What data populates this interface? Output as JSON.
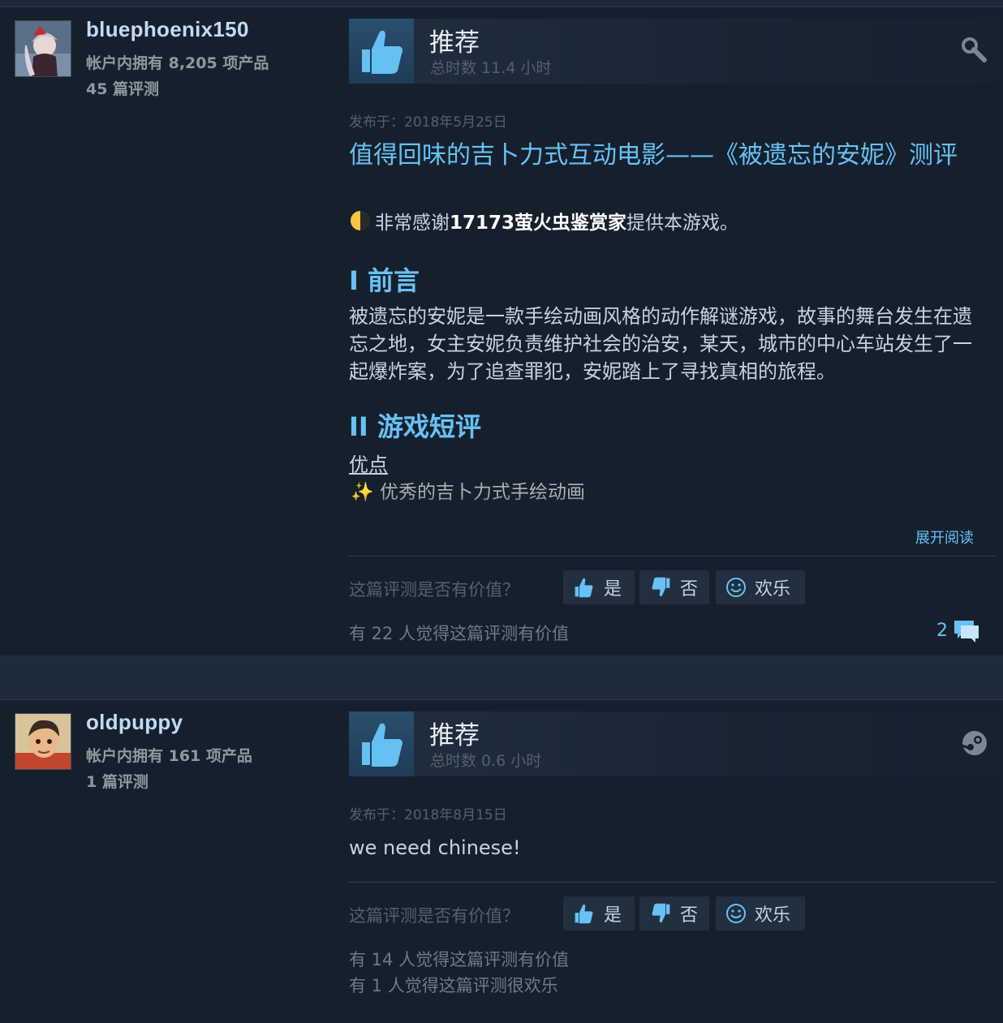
{
  "reviews": [
    {
      "author": {
        "name": "bluephoenix150",
        "products": "帐户内拥有 8,205 项产品",
        "reviews": "45 篇评测"
      },
      "recommendation": "推荐",
      "hours": "总时数 11.4 小时",
      "corner_icon": "wrench-icon",
      "posted": "发布于：2018年5月25日",
      "title": "值得回味的吉卜力式互动电影——《被遗忘的安妮》测评",
      "thanks": {
        "before": "非常感谢",
        "bold": "17173萤火虫鉴赏家",
        "after": "提供本游戏。"
      },
      "section1": "I 前言",
      "paragraph": "被遗忘的安妮是一款手绘动画风格的动作解谜游戏，故事的舞台发生在遗忘之地，女主安妮负责维护社会的治安，某天，城市的中心车站发生了一起爆炸案，为了追查罪犯，安妮踏上了寻找真相的旅程。",
      "section2": "II 游戏短评",
      "pros_label": "优点",
      "pros_item": "优秀的吉卜力式手绘动画",
      "expand": "展开阅读",
      "helpful_question": "这篇评测是否有价值？",
      "buttons": {
        "yes": "是",
        "no": "否",
        "funny": "欢乐"
      },
      "helpful_count": "有 22 人觉得这篇评测有价值",
      "comments": "2"
    },
    {
      "author": {
        "name": "oldpuppy",
        "products": "帐户内拥有 161 项产品",
        "reviews": "1 篇评测"
      },
      "recommendation": "推荐",
      "hours": "总时数 0.6 小时",
      "corner_icon": "steam-icon",
      "posted": "发布于：2018年8月15日",
      "text": "we need chinese!",
      "helpful_question": "这篇评测是否有价值？",
      "buttons": {
        "yes": "是",
        "no": "否",
        "funny": "欢乐"
      },
      "helpful_count": "有 14 人觉得这篇评测有价值",
      "funny_count": "有 1 人觉得这篇评测很欢乐"
    }
  ],
  "colors": {
    "background": "#1b2838",
    "link": "#67c1f5",
    "text": "#c6d4df",
    "muted": "#56606b"
  }
}
